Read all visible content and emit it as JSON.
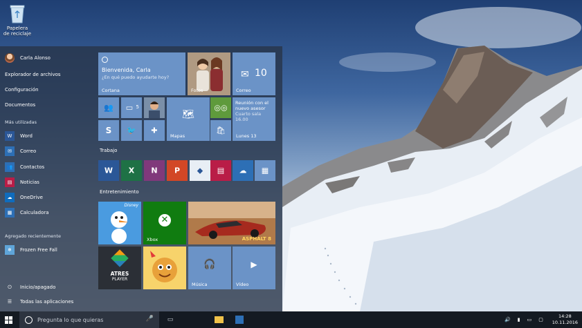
{
  "desktop": {
    "recycle_bin_label_1": "Papelera",
    "recycle_bin_label_2": "de reciclaje"
  },
  "start_menu": {
    "user_name": "Carla Alonso",
    "links": [
      "Explorador de archivos",
      "Configuración",
      "Documentos"
    ],
    "most_used_title": "Más utilizadas",
    "most_used": [
      {
        "label": "Word",
        "color": "#2b5797",
        "icon": "word-icon"
      },
      {
        "label": "Correo",
        "color": "#2d6fb5",
        "icon": "mail-icon"
      },
      {
        "label": "Contactos",
        "color": "#2d6fb5",
        "icon": "people-icon"
      },
      {
        "label": "Noticias",
        "color": "#b91d47",
        "icon": "news-icon"
      },
      {
        "label": "OneDrive",
        "color": "#0f6cbd",
        "icon": "cloud-icon"
      },
      {
        "label": "Calculadora",
        "color": "#2d6fb5",
        "icon": "calculator-icon"
      }
    ],
    "recent_title": "Agregado recientemente",
    "recent_app": "Frozen Free Fall",
    "power": "Inicio/apagado",
    "all_apps": "Todas las aplicaciones"
  },
  "tiles": {
    "cortana_greeting": "Bienvenida, Carla",
    "cortana_question": "¿En qué puedo ayudarte hoy?",
    "cortana_label": "Cortana",
    "photos_label": "Fotos",
    "mail_count": "10",
    "mail_label": "Correo",
    "calendar_text_1": "Reunión con el",
    "calendar_text_2": "nuevo asesor",
    "calendar_text_3": "Cuarto sala",
    "calendar_text_4": "16.00",
    "calendar_label": "Lunes 13",
    "people_badge": "5",
    "maps_label": "Mapas",
    "work_group": "Trabajo",
    "entertainment_group": "Entretenimiento",
    "disney_label": "Disney",
    "xbox_label": "Xbox",
    "asphalt_label": "ASPHALT 8",
    "atres_label_1": "ATRES",
    "atres_label_2": "PLAYER",
    "music_label": "Música",
    "video_label": "Vídeo",
    "accent": "#6b93c7"
  },
  "taskbar": {
    "search_placeholder": "Pregunta lo que quieras",
    "time": "14:28",
    "date": "10.11.2016"
  }
}
